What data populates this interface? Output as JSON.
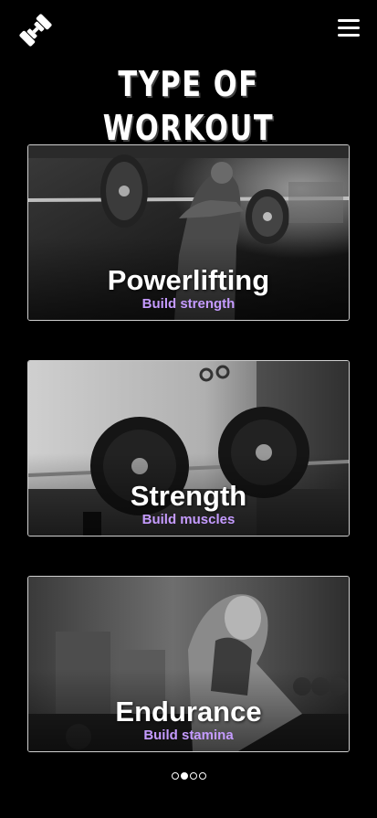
{
  "header": {
    "logo_icon": "dumbbell-icon",
    "menu_icon": "hamburger-menu-icon"
  },
  "page": {
    "title": "TYPE OF WORKOUT"
  },
  "cards": [
    {
      "title": "Powerlifting",
      "subtitle": "Build strength"
    },
    {
      "title": "Strength",
      "subtitle": "Build muscles"
    },
    {
      "title": "Endurance",
      "subtitle": "Build stamina"
    }
  ],
  "pagination": {
    "count": 4,
    "active_index": 1
  },
  "colors": {
    "background": "#000000",
    "accent": "#c59bff",
    "text": "#ffffff"
  }
}
